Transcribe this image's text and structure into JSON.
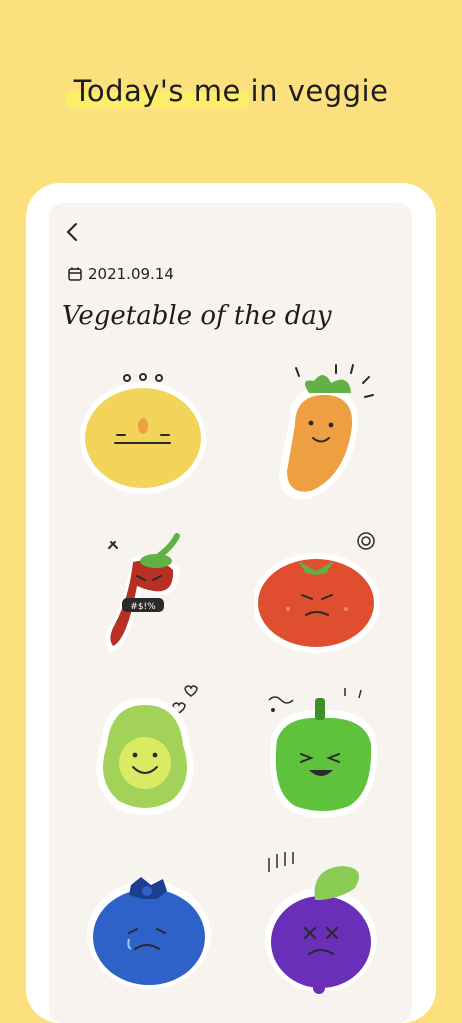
{
  "headline": "Today's me in veggie",
  "screen": {
    "date": "2021.09.14",
    "title": "Vegetable of the day"
  },
  "stickers": [
    {
      "name": "potato",
      "color": "#F2D45A"
    },
    {
      "name": "carrot",
      "color": "#EE9F42"
    },
    {
      "name": "chili",
      "color": "#B83024",
      "label": "#$!%"
    },
    {
      "name": "tomato",
      "color": "#DE4E2F"
    },
    {
      "name": "avocado",
      "color": "#A3D258"
    },
    {
      "name": "bell-pepper",
      "color": "#5EC23D"
    },
    {
      "name": "blueberry",
      "color": "#2E62C9"
    },
    {
      "name": "radish",
      "color": "#6A2FB8"
    }
  ]
}
